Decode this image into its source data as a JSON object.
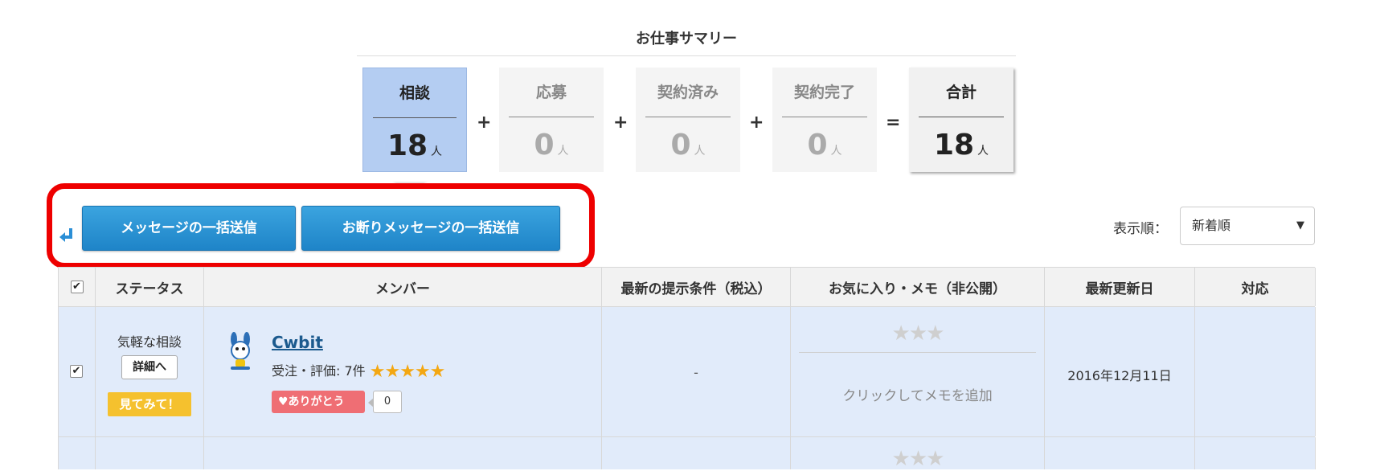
{
  "summary": {
    "title": "お仕事サマリー",
    "cards": [
      {
        "label": "相談",
        "value": "18",
        "unit": "人"
      },
      {
        "label": "応募",
        "value": "0",
        "unit": "人"
      },
      {
        "label": "契約済み",
        "value": "0",
        "unit": "人"
      },
      {
        "label": "契約完了",
        "value": "0",
        "unit": "人"
      },
      {
        "label": "合計",
        "value": "18",
        "unit": "人"
      }
    ],
    "ops": [
      "+",
      "+",
      "+",
      "="
    ]
  },
  "actions": {
    "bulk_message": "メッセージの一括送信",
    "bulk_decline": "お断りメッセージの一括送信"
  },
  "sort": {
    "label": "表示順：",
    "selected": "新着順",
    "caret": "▼"
  },
  "table": {
    "headers": {
      "check": "✔",
      "status": "ステータス",
      "member": "メンバー",
      "terms": "最新の提示条件（税込）",
      "favorite": "お気に入り・メモ（非公開）",
      "updated": "最新更新日",
      "action": "対応"
    },
    "rows": [
      {
        "check": "✔",
        "status": "気軽な相談",
        "detail_button": "詳細へ",
        "badge": "見てみて！",
        "member_name": "Cwbit",
        "rating_label": "受注・評価: 7件",
        "rating_stars": "★★★★★",
        "thanks_label": "♥ありがとう",
        "thanks_count": "0",
        "terms": "-",
        "favorite_stars": "★★★",
        "memo": "クリックしてメモを追加",
        "updated": "2016年12月11日"
      },
      {
        "favorite_stars": "★★★"
      }
    ]
  },
  "colors": {
    "accent_blue": "#2596d9",
    "highlight_red": "#ee0000",
    "badge_yellow": "#f5c12e",
    "row_bg": "#e1ebfa"
  }
}
